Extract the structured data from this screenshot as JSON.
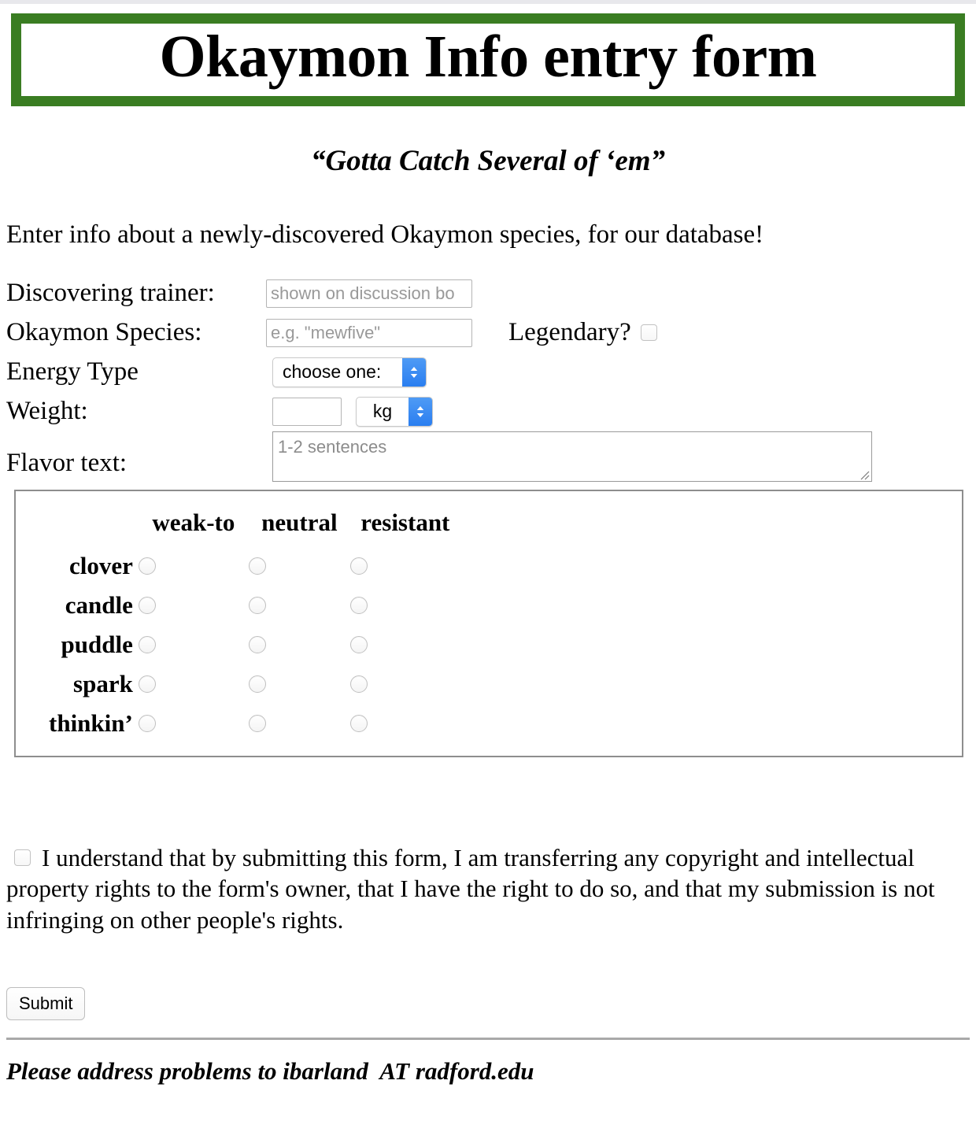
{
  "page": {
    "title": "Okaymon Info entry form",
    "tagline": "“Gotta Catch Several of ‘em”",
    "intro": "Enter info about a newly-discovered Okaymon species, for our database!",
    "accent_green": "#3a7d22",
    "select_button_blue": "#2a7ef0",
    "fieldset_border": "#8e8e8e",
    "rule_color": "#a9a9a9"
  },
  "form": {
    "trainer": {
      "label": "Discovering trainer:",
      "placeholder": "shown on discussion bo",
      "value": ""
    },
    "species": {
      "label": "Okaymon Species:",
      "placeholder": "e.g. \"mewfive\"",
      "value": ""
    },
    "legendary": {
      "label": "Legendary?",
      "checked": false
    },
    "energy": {
      "label": "Energy Type",
      "selected": "choose one:"
    },
    "weight": {
      "label": "Weight:",
      "value": "",
      "placeholder": "",
      "unit_selected": "kg"
    },
    "flavor": {
      "label": "Flavor text:",
      "placeholder": "1-2 sentences",
      "value": ""
    }
  },
  "matrix": {
    "columns": [
      "weak-to",
      "neutral",
      "resistant"
    ],
    "rows": [
      {
        "label": "clover",
        "selected": null
      },
      {
        "label": "candle",
        "selected": null
      },
      {
        "label": "puddle",
        "selected": null
      },
      {
        "label": "spark",
        "selected": null
      },
      {
        "label": "thinkin’",
        "selected": null
      }
    ]
  },
  "copyright": {
    "checked": false,
    "text": "I understand that by submitting this form, I am transferring any copyright and intellectual property rights to the form's owner, that I have the right to do so, and that my submission is not infringing on other people's rights."
  },
  "submit": {
    "label": "Submit"
  },
  "footer": {
    "text": "Please address problems to ibarland  AT radford.edu"
  }
}
